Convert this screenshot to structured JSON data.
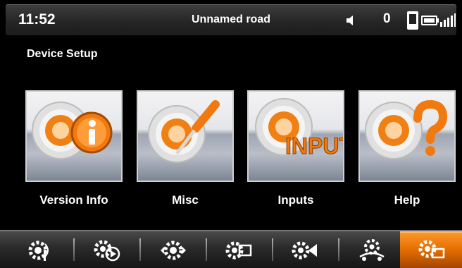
{
  "status_bar": {
    "time": "11:52",
    "road": "Unnamed road",
    "speaker_icon": "speaker-icon",
    "count": "0",
    "phone_icon": "phone-icon",
    "battery_icon": "battery-icon",
    "signal_icon": "signal-icon"
  },
  "page": {
    "title": "Device Setup"
  },
  "tiles": [
    {
      "label": "Version Info",
      "icon": "gear-info-icon"
    },
    {
      "label": "Misc",
      "icon": "gear-screwdriver-icon"
    },
    {
      "label": "Inputs",
      "icon": "gear-input-icon",
      "image_text": "INPUT"
    },
    {
      "label": "Help",
      "icon": "gear-help-icon"
    }
  ],
  "bottom_nav": {
    "items": [
      {
        "icon": "gear-antenna-icon",
        "active": false
      },
      {
        "icon": "gear-play-icon",
        "active": false
      },
      {
        "icon": "gear-arrows-icon",
        "active": false
      },
      {
        "icon": "gear-screen-icon",
        "active": false
      },
      {
        "icon": "gear-camera-icon",
        "active": false
      },
      {
        "icon": "gear-car-icon",
        "active": false
      },
      {
        "icon": "gear-display-icon",
        "active": true
      }
    ]
  },
  "colors": {
    "accent_orange": "#f07a10",
    "background": "#000000",
    "text": "#ffffff"
  }
}
